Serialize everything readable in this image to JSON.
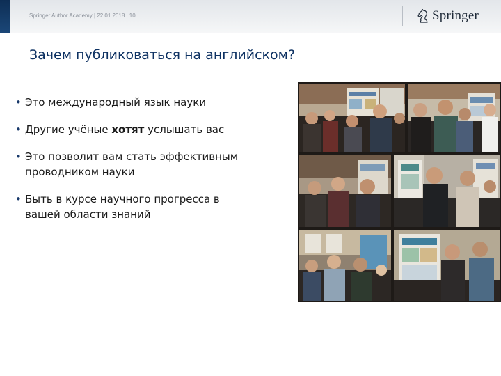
{
  "header": {
    "meta_text": "Springer Author Academy | 22.01.2018 | 10",
    "logo_text": "Springer",
    "logo_icon": "chess-knight-icon"
  },
  "slide": {
    "title": "Зачем публиковаться на английском?",
    "bullets": [
      {
        "text": "Это международный язык науки"
      },
      {
        "pre": "Другие учёные ",
        "bold": "хотят",
        "post": " услышать вас"
      },
      {
        "line1": "Это позволит вам стать эффективным",
        "line2": "проводником науки"
      },
      {
        "line1": "Быть в курсе научного прогресса в",
        "line2": "вашей области знаний"
      }
    ]
  },
  "photo": {
    "description_icon": "conference-photo-collage"
  },
  "colors": {
    "accent": "#1b4778",
    "title": "#0d3162",
    "bullet_marker": "#17386a"
  }
}
